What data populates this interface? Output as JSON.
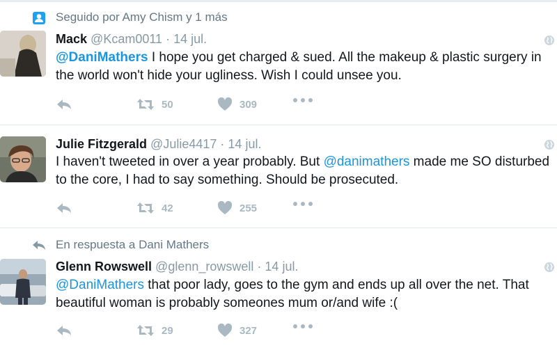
{
  "tweets": [
    {
      "context_text": "Seguido por Amy Chism y 1 más",
      "context_icon": "follow-person-icon",
      "name": "Mack",
      "handle": "@Kcam0011",
      "separator": "·",
      "date": "14 jul.",
      "text_mention": "@DaniMathers",
      "text_before": "",
      "text_after": " I hope you get charged & sued. All the makeup & plastic surgery in the world won't hide your ugliness. Wish I could unsee you.",
      "retweets": "50",
      "likes": "309"
    },
    {
      "name": "Julie Fitzgerald",
      "handle": "@Julie4417",
      "separator": "·",
      "date": "14 jul.",
      "text_before": "I haven't tweeted in over a year probably. But ",
      "text_mention": "@danimathers",
      "text_after": " made me SO disturbed to the core, I had to say something. Should be prosecuted.",
      "retweets": "42",
      "likes": "255"
    },
    {
      "context_text": "En respuesta a Dani Mathers",
      "context_icon": "reply-icon",
      "name": "Glenn Rowswell",
      "handle": "@glenn_rowswell",
      "separator": "·",
      "date": "14 jul.",
      "text_before": "",
      "text_mention": "@DaniMathers",
      "text_after": " that poor lady, goes to the gym and ends up all over the net. That beautiful woman is probably someones mum or/and wife :(",
      "retweets": "29",
      "likes": "327"
    }
  ],
  "colors": {
    "link": "#1b95e0",
    "muted": "#8899a6",
    "action_icon": "#aab8c2",
    "divider": "#e1e8ed"
  }
}
